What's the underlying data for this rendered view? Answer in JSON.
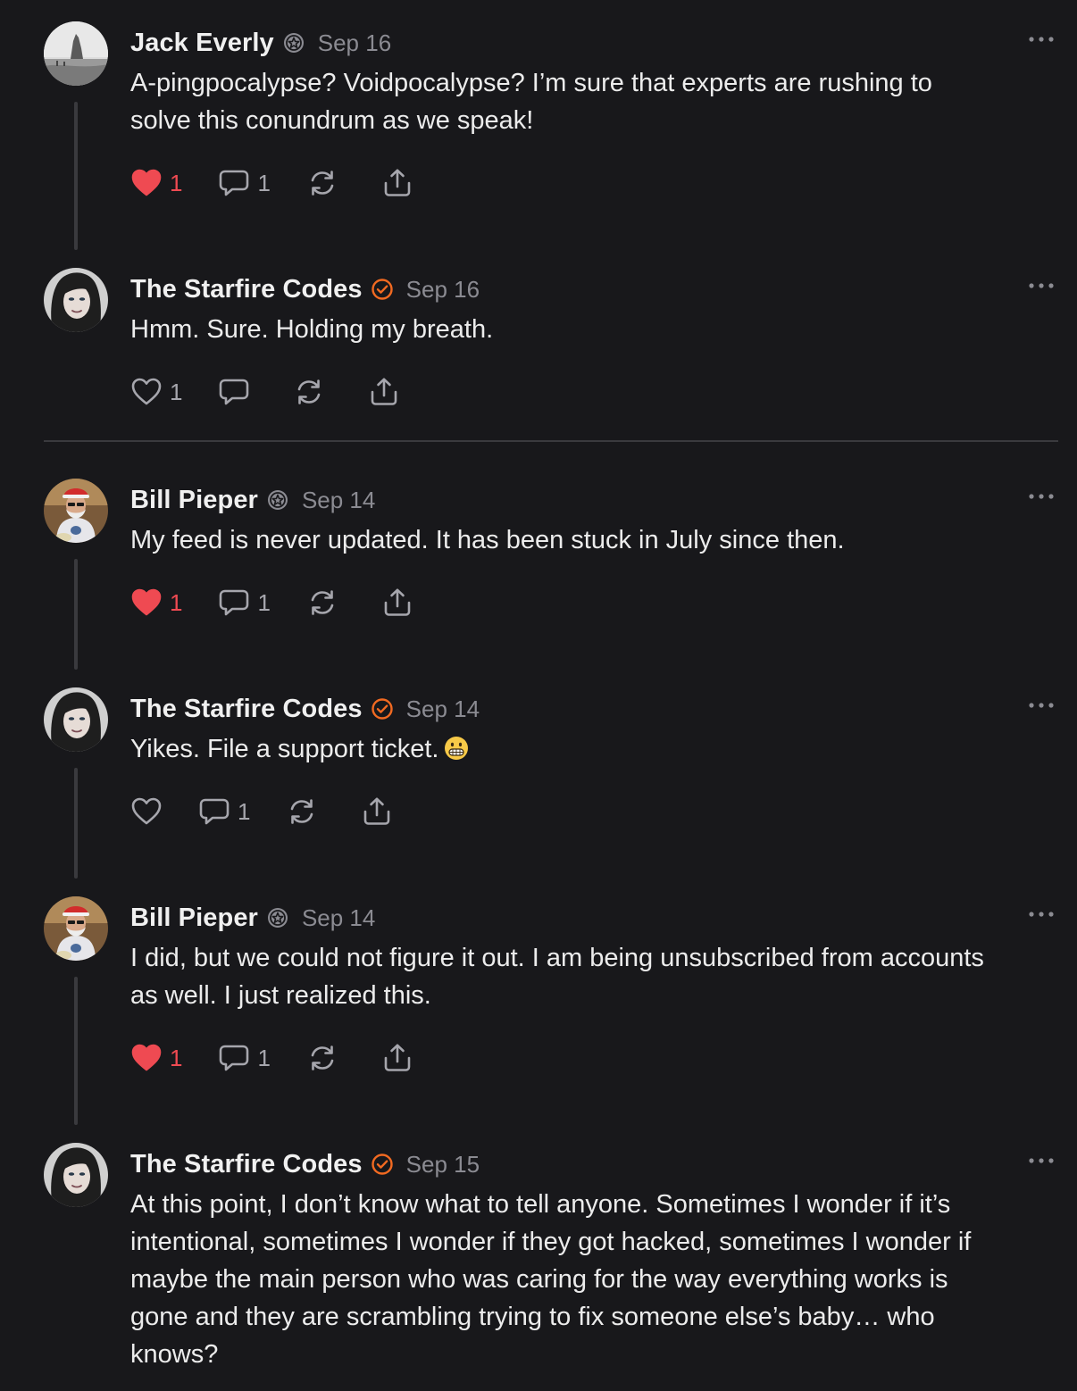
{
  "colors": {
    "background": "#18181b",
    "liked": "#ef4a52",
    "verified": "#f26a21",
    "muted": "#8b8b92"
  },
  "comments": [
    {
      "author": "Jack Everly",
      "badge": "subscriber-badge-icon",
      "date": "Sep 16",
      "text": "A-pingpocalypse? Voidpocalypse? I’m sure that experts are rushing to\nsolve this conundrum as we speak!",
      "likes": "1",
      "liked": true,
      "replies": "1"
    },
    {
      "author": "The Starfire Codes",
      "badge": "verified-check-icon",
      "date": "Sep 16",
      "text": "Hmm. Sure. Holding my breath.",
      "likes": "1",
      "liked": false,
      "replies": ""
    },
    {
      "author": "Bill Pieper",
      "badge": "subscriber-badge-icon",
      "date": "Sep 14",
      "text": "My feed is never updated. It has been stuck in July since then.",
      "likes": "1",
      "liked": true,
      "replies": "1"
    },
    {
      "author": "The Starfire Codes",
      "badge": "verified-check-icon",
      "date": "Sep 14",
      "text": "Yikes. File a support ticket.",
      "emoji": "grimacing-face-emoji",
      "likes": "",
      "liked": false,
      "replies": "1"
    },
    {
      "author": "Bill Pieper",
      "badge": "subscriber-badge-icon",
      "date": "Sep 14",
      "text": "I did, but we could not figure it out. I am being unsubscribed from accounts\nas well. I just realized this.",
      "likes": "1",
      "liked": true,
      "replies": "1"
    },
    {
      "author": "The Starfire Codes",
      "badge": "verified-check-icon",
      "date": "Sep 15",
      "text": "At this point, I don’t know what to tell anyone. Sometimes I wonder if it’s\nintentional, sometimes I wonder if they got hacked, sometimes I wonder if\nmaybe the main person who was caring for the way everything works is\ngone and they are scrambling trying to fix someone else’s baby… who\nknows?"
    }
  ]
}
